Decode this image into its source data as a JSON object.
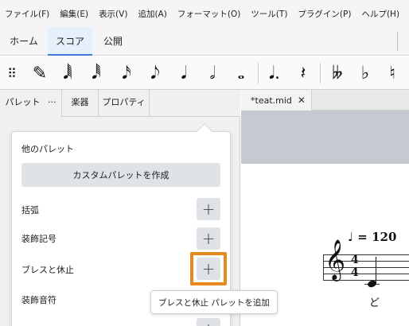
{
  "menu": [
    "ファイル(F)",
    "編集(E)",
    "表示(V)",
    "追加(A)",
    "フォーマット(O)",
    "ツール(T)",
    "プラグイン(P)",
    "ヘルプ(H)"
  ],
  "workspace_tabs": {
    "home": "ホーム",
    "score": "スコア",
    "publish": "公開"
  },
  "toolbar": {
    "icons": [
      "drag-handle-icon",
      "pencil-icon",
      "64th-note-icon",
      "32nd-note-icon",
      "16th-note-icon",
      "eighth-note-icon",
      "quarter-note-icon",
      "half-note-icon",
      "whole-note-icon",
      "augmentation-dot-icon",
      "rest-icon",
      "double-flat-icon",
      "flat-icon",
      "natural-icon"
    ],
    "glyphs": {
      "drag": "⠿",
      "pencil": "✎",
      "n64": "𝅘𝅥𝅲",
      "n32": "𝅘𝅥𝅱",
      "n16": "𝅘𝅥𝅯",
      "n8": "𝅘𝅥𝅮",
      "n4": "𝅘𝅥",
      "n2": "𝅗𝅥",
      "n1": "𝅝",
      "dot": "𝅘𝅥.",
      "rest": "𝄽",
      "dflat": "𝄫",
      "flat": "♭",
      "natural": "♮"
    }
  },
  "panel_tabs": {
    "palettes": "パレット",
    "more": "···",
    "instruments": "楽器",
    "properties": "プロパティ"
  },
  "popup": {
    "title": "他のパレット",
    "create_button": "カスタムパレットを作成",
    "items": [
      {
        "label": "括弧",
        "add": "+"
      },
      {
        "label": "装飾記号",
        "add": "+"
      },
      {
        "label": "ブレスと休止",
        "add": "+"
      },
      {
        "label": "装飾音符",
        "add": "+"
      },
      {
        "label": "",
        "add": "+"
      }
    ]
  },
  "tooltip": "ブレスと休止 パレットを追加",
  "score_tab": {
    "name": "*teat.mid",
    "close": "✕"
  },
  "score": {
    "tempo": "♩ = 120",
    "clef": "𝄞",
    "time_top": "4",
    "time_bottom": "4",
    "lyric": "ど"
  },
  "colors": {
    "accent": "#3b7bd4",
    "focus": "#e8891f",
    "canvas_gray": "#c5c9d0"
  }
}
